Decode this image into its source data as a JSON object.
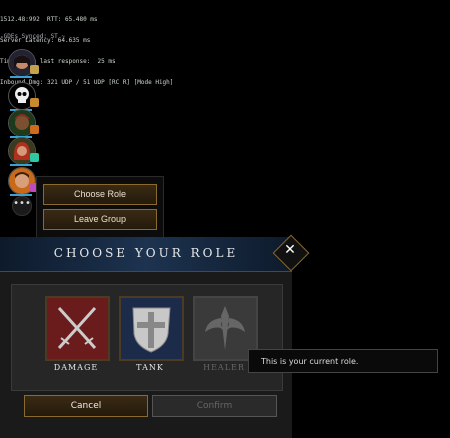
{
  "debug": {
    "lines": [
      "1512.48:992  RTT: 65.480 ms",
      "Server Latency: 64.635 ms",
      "Time since last response:  25 ms",
      "Inbound Dmg: 321 UDP / 51 UDP [RC R] [Mode High]"
    ],
    "gde_status": "-GDEs Synced: ST ~"
  },
  "context_menu": {
    "choose_role": "Choose Role",
    "leave_group": "Leave Group"
  },
  "more_button": "•••",
  "dialog": {
    "title": "CHOOSE YOUR ROLE",
    "close": "✕",
    "roles": [
      {
        "label": "DAMAGE",
        "bg": "#6a1c1c"
      },
      {
        "label": "TANK",
        "bg": "#1b2b49"
      },
      {
        "label": "HEALER",
        "bg": "#3a3a3a"
      }
    ],
    "cancel": "Cancel",
    "confirm": "Confirm",
    "tooltip": "This is your current role."
  },
  "colors": {
    "accent_gold": "#8a6a2e",
    "health_blue": "#3ca0d0"
  },
  "party": [
    {
      "icon": "portrait-woman-dark-hair",
      "badge": "#c7a24c"
    },
    {
      "icon": "skull-icon",
      "badge": "#c98a2e"
    },
    {
      "icon": "portrait-green",
      "badge": "#d06a1f"
    },
    {
      "icon": "portrait-red-hair",
      "badge": "#2ec9a4"
    },
    {
      "icon": "portrait-man-orange",
      "badge": "#c04ac0"
    }
  ]
}
